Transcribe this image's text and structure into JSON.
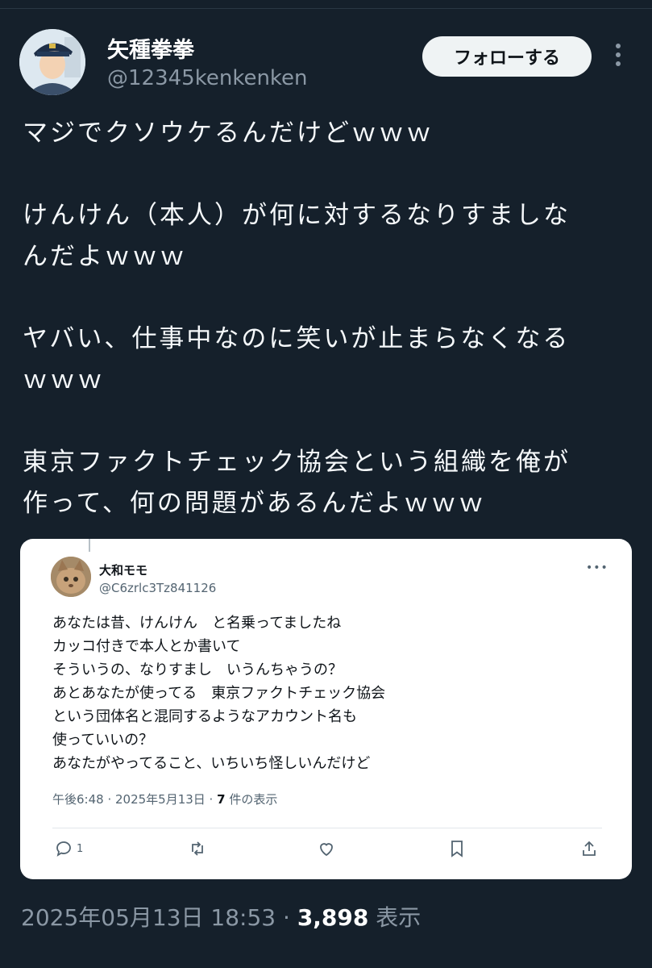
{
  "user": {
    "display_name": "矢種拳拳",
    "handle": "@12345kenkenken",
    "avatar": "avatar-icon"
  },
  "follow_label": "フォローする",
  "tweet": {
    "paragraphs": [
      "マジでクソウケるんだけどｗｗｗ",
      "けんけん（本人）が何に対するなりすましな\nんだよｗｗｗ",
      "ヤバい、仕事中なのに笑いが止まらなくなる\nｗｗｗ",
      "東京ファクトチェック協会という組織を俺が\n作って、何の問題があるんだよｗｗｗ"
    ]
  },
  "quoted": {
    "display_name": "大和モモ",
    "handle": "@C6zrlc3Tz841126",
    "lines": [
      "あなたは昔、けんけん　と名乗ってましたね",
      "カッコ付きで本人とか書いて",
      "そういうの、なりすまし　いうんちゃうの？",
      "あとあなたが使ってる　東京ファクトチェック協会",
      "という団体名と混同するようなアカウント名も",
      "使っていいの？",
      "あなたがやってること、いちいち怪しいんだけど"
    ],
    "meta_time": "午後6:48 · 2025年5月13日 · ",
    "meta_views_count": "7",
    "meta_views_label": " 件の表示",
    "reply_count": "1"
  },
  "footer": {
    "datetime": "2025年05月13日 18:53 · ",
    "views": "3,898",
    "views_label": " 表示"
  },
  "colors": {
    "background": "#15202b",
    "secondary_text": "#8b98a5",
    "card_background": "#ffffff"
  }
}
